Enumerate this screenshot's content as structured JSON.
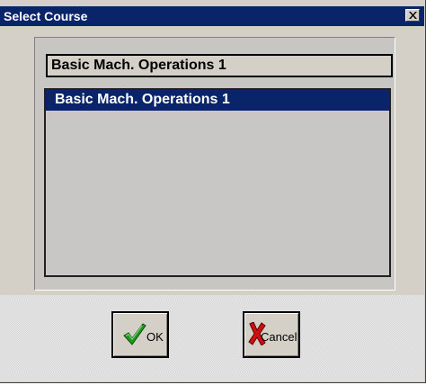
{
  "window": {
    "title": "Select Course",
    "close_glyph": "×"
  },
  "selected_course": "Basic Mach. Operations 1",
  "course_list": {
    "items": [
      "Basic Mach. Operations 1"
    ],
    "selected_index": 0
  },
  "buttons": {
    "ok": {
      "label": "OK",
      "icon": "green-checkmark-icon"
    },
    "cancel": {
      "label": "Cancel",
      "icon": "red-x-icon"
    }
  },
  "colors": {
    "titlebar": "#0a246a",
    "selection": "#0a246a",
    "face": "#d4d0c8"
  }
}
